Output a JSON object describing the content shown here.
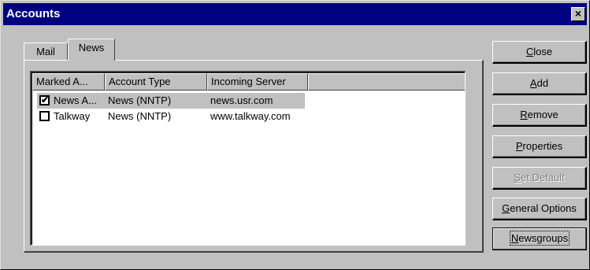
{
  "window": {
    "title": "Accounts",
    "close_glyph": "×"
  },
  "tabs": [
    {
      "label": "Mail",
      "active": false
    },
    {
      "label": "News",
      "active": true
    }
  ],
  "columns": [
    "Marked A...",
    "Account Type",
    "Incoming Server"
  ],
  "rows": [
    {
      "checked": true,
      "name": "News A...",
      "type": "News (NNTP)",
      "server": "news.usr.com",
      "selected": true
    },
    {
      "checked": false,
      "name": "Talkway",
      "type": "News (NNTP)",
      "server": "www.talkway.com",
      "selected": false
    }
  ],
  "buttons": {
    "close": {
      "mnemonic": "C",
      "rest": "lose"
    },
    "add": {
      "mnemonic": "A",
      "rest": "dd"
    },
    "remove": {
      "mnemonic": "R",
      "rest": "emove"
    },
    "properties": {
      "mnemonic": "P",
      "rest": "roperties"
    },
    "set_default": {
      "mnemonic": "S",
      "rest": "et Default",
      "disabled": true
    },
    "general_options": {
      "mnemonic": "G",
      "rest": "eneral Options"
    },
    "newsgroups": {
      "mnemonic": "N",
      "rest": "ewsgroups",
      "focused": true
    }
  },
  "checkmark": "✔"
}
